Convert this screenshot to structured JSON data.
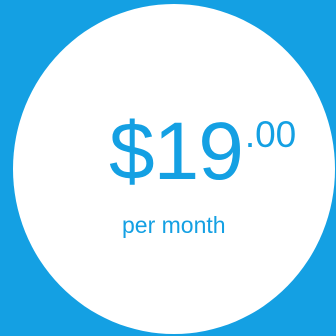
{
  "pricing_badge": {
    "price_main": "$19",
    "price_cents": ".00",
    "period": "per month"
  },
  "colors": {
    "background": "#14a0e3",
    "circle": "#ffffff",
    "price_text": "#14a0e3"
  }
}
